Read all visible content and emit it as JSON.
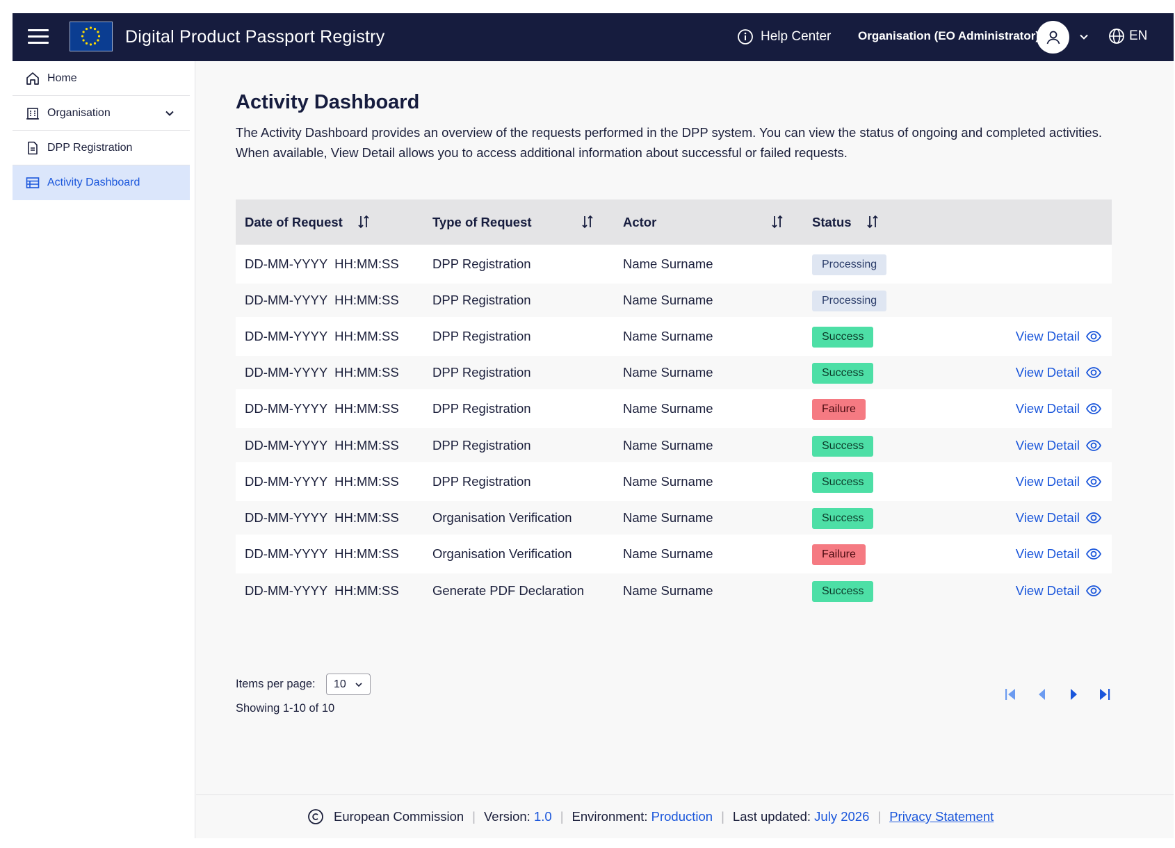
{
  "header": {
    "app_title": "Digital Product Passport Registry",
    "help_label": "Help Center",
    "org_label": "Organisation (EO Administrator)",
    "language": "EN",
    "brand_color": "#161c3e"
  },
  "sidebar": {
    "items": [
      {
        "label": "Home",
        "icon": "home-icon"
      },
      {
        "label": "Organisation",
        "icon": "building-icon"
      },
      {
        "label": "DPP Registration",
        "icon": "document-icon"
      },
      {
        "label": "Activity Dashboard",
        "icon": "table-icon",
        "active": true
      }
    ]
  },
  "main": {
    "title": "Activity Dashboard",
    "description": "The Activity Dashboard provides an overview of the requests performed in the DPP system. You can view the status of ongoing and completed activities. When available, View Detail allows you to access additional information about successful or failed requests."
  },
  "table": {
    "columns": [
      "Date of Request",
      "Type of Request",
      "Actor",
      "Status"
    ],
    "view_detail_label": "View Detail",
    "rows": [
      {
        "date": "DD-MM-YYYY  HH:MM:SS",
        "type": "DPP Registration",
        "actor": "Name Surname",
        "status": "Processing",
        "detail": false
      },
      {
        "date": "DD-MM-YYYY  HH:MM:SS",
        "type": "DPP Registration",
        "actor": "Name Surname",
        "status": "Processing",
        "detail": false
      },
      {
        "date": "DD-MM-YYYY  HH:MM:SS",
        "type": "DPP Registration",
        "actor": "Name Surname",
        "status": "Success",
        "detail": true
      },
      {
        "date": "DD-MM-YYYY  HH:MM:SS",
        "type": "DPP Registration",
        "actor": "Name Surname",
        "status": "Success",
        "detail": true
      },
      {
        "date": "DD-MM-YYYY  HH:MM:SS",
        "type": "DPP Registration",
        "actor": "Name Surname",
        "status": "Failure",
        "detail": true
      },
      {
        "date": "DD-MM-YYYY  HH:MM:SS",
        "type": "DPP Registration",
        "actor": "Name Surname",
        "status": "Success",
        "detail": true
      },
      {
        "date": "DD-MM-YYYY  HH:MM:SS",
        "type": "DPP Registration",
        "actor": "Name Surname",
        "status": "Success",
        "detail": true
      },
      {
        "date": "DD-MM-YYYY  HH:MM:SS",
        "type": "Organisation Verification",
        "actor": "Name Surname",
        "status": "Success",
        "detail": true
      },
      {
        "date": "DD-MM-YYYY  HH:MM:SS",
        "type": "Organisation Verification",
        "actor": "Name Surname",
        "status": "Failure",
        "detail": true
      },
      {
        "date": "DD-MM-YYYY  HH:MM:SS",
        "type": "Generate PDF Declaration",
        "actor": "Name Surname",
        "status": "Success",
        "detail": true
      }
    ]
  },
  "pagination": {
    "items_per_page_label": "Items per page:",
    "items_per_page": "10",
    "showing": "Showing 1-10 of 10"
  },
  "footer": {
    "org": "European Commission",
    "version_label": "Version:",
    "version": "1.0",
    "environment_label": "Environment:",
    "environment": "Production",
    "updated_label": "Last updated:",
    "updated": "July 2026",
    "privacy": "Privacy Statement"
  },
  "colors": {
    "accent": "#1a56db",
    "success": "#4ddfa6",
    "failure": "#f57a82",
    "processing": "#dfe6f2"
  }
}
